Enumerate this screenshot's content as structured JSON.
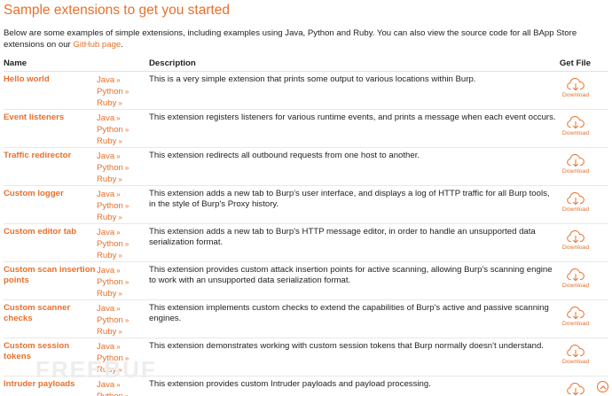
{
  "heading": "Sample extensions to get you started",
  "intro": {
    "text": "Below are some examples of simple extensions, including examples using Java, Python and Ruby. You can also view the source code for all BApp Store extensions on our ",
    "link": "GitHub page",
    "end": "."
  },
  "table": {
    "headers": {
      "name": "Name",
      "description": "Description",
      "get": "Get File"
    },
    "download_label": "Download",
    "accent_color": "#e8702a",
    "rows": [
      {
        "name": "Hello world",
        "langs": [
          "Java",
          "Python",
          "Ruby"
        ],
        "description": "This is a very simple extension that prints some output to various locations within Burp."
      },
      {
        "name": "Event listeners",
        "langs": [
          "Java",
          "Python",
          "Ruby"
        ],
        "description": "This extension registers listeners for various runtime events, and prints a message when each event occurs."
      },
      {
        "name": "Traffic redirector",
        "langs": [
          "Java",
          "Python",
          "Ruby"
        ],
        "description": "This extension redirects all outbound requests from one host to another."
      },
      {
        "name": "Custom logger",
        "langs": [
          "Java",
          "Python",
          "Ruby"
        ],
        "description": "This extension adds a new tab to Burp's user interface, and displays a log of HTTP traffic for all Burp tools, in the style of Burp's Proxy history."
      },
      {
        "name": "Custom editor tab",
        "langs": [
          "Java",
          "Python",
          "Ruby"
        ],
        "description": "This extension adds a new tab to Burp's HTTP message editor, in order to handle an unsupported data serialization format."
      },
      {
        "name": "Custom scan insertion points",
        "langs": [
          "Java",
          "Python",
          "Ruby"
        ],
        "description": "This extension provides custom attack insertion points for active scanning, allowing Burp's scanning engine to work with an unsupported data serialization format."
      },
      {
        "name": "Custom scanner checks",
        "langs": [
          "Java",
          "Python",
          "Ruby"
        ],
        "description": "This extension implements custom checks to extend the capabilities of Burp's active and passive scanning engines."
      },
      {
        "name": "Custom session tokens",
        "langs": [
          "Java",
          "Python",
          "Ruby"
        ],
        "description": "This extension demonstrates working with custom session tokens that Burp normally doesn't understand."
      },
      {
        "name": "Intruder payloads",
        "langs": [
          "Java",
          "Python"
        ],
        "description": "This extension provides custom Intruder payloads and payload processing."
      }
    ]
  },
  "watermark": "FREEBUF",
  "icons": {
    "download": "cloud-download-icon",
    "scroll_top": "chevron-up-icon",
    "lang_link": "double-chevron-right-icon"
  }
}
